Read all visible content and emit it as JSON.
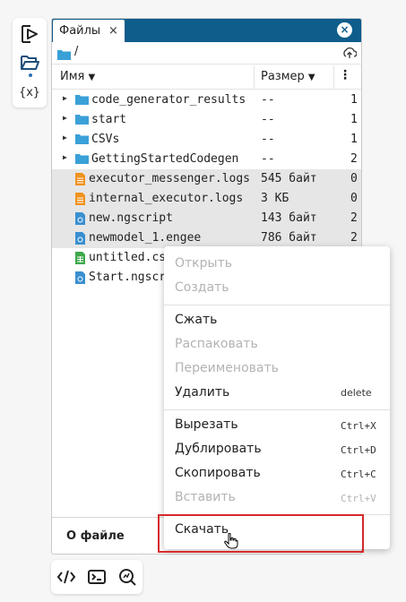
{
  "side_toolbar": {
    "icons": [
      "run-icon",
      "folder-open-icon",
      "variables-icon"
    ]
  },
  "bottom_toolbar": {
    "icons": [
      "code-icon",
      "terminal-icon",
      "search-graph-icon"
    ]
  },
  "panel": {
    "tab_label": "Файлы",
    "tab_close": "×",
    "close": "×",
    "path": "/",
    "header": {
      "name": "Имя",
      "size": "Размер",
      "sort_arrow": "▼",
      "more": "⋮"
    },
    "rows": [
      {
        "name": "code_generator_results",
        "size": "--",
        "extra": "1",
        "type": "folder"
      },
      {
        "name": "start",
        "size": "--",
        "extra": "1",
        "type": "folder"
      },
      {
        "name": "CSVs",
        "size": "--",
        "extra": "1",
        "type": "folder"
      },
      {
        "name": "GettingStartedCodegen",
        "size": "--",
        "extra": "2",
        "type": "folder"
      },
      {
        "name": "executor_messenger.logs",
        "size": "545 байт",
        "extra": "0",
        "type": "log",
        "selected": true
      },
      {
        "name": "internal_executor.logs",
        "size": "3 КБ",
        "extra": "0",
        "type": "log",
        "selected": true
      },
      {
        "name": "new.ngscript",
        "size": "143 байт",
        "extra": "2",
        "type": "script",
        "selected": true
      },
      {
        "name": "newmodel_1.engee",
        "size": "786 байт",
        "extra": "2",
        "type": "script",
        "selected": true
      },
      {
        "name": "untitled.cs",
        "size": "",
        "extra": "",
        "type": "csv"
      },
      {
        "name": "Start.ngscr",
        "size": "",
        "extra": "",
        "type": "script"
      }
    ],
    "about_label": "О файле"
  },
  "context_menu": {
    "open": "Открыть",
    "create": "Создать",
    "compress": "Сжать",
    "extract": "Распаковать",
    "rename": "Переименовать",
    "delete": "Удалить",
    "delete_sc": "delete",
    "cut": "Вырезать",
    "cut_sc": "Ctrl+X",
    "duplicate": "Дублировать",
    "duplicate_sc": "Ctrl+D",
    "copy": "Скопировать",
    "copy_sc": "Ctrl+C",
    "paste": "Вставить",
    "paste_sc": "Ctrl+V",
    "download": "Скачать"
  },
  "colors": {
    "accent": "#0e5d8a",
    "folder": "#3aa0d8",
    "log": "#f0921f",
    "highlight": "#d62a2a"
  }
}
